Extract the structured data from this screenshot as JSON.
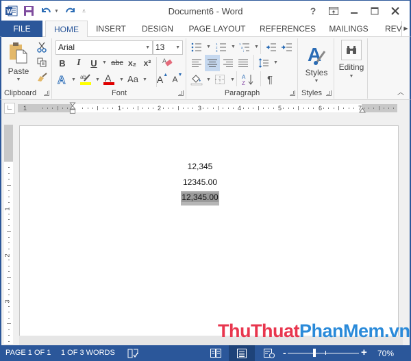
{
  "app": {
    "title": "Document6 - Word",
    "brand_color": "#2b579a"
  },
  "qat": {
    "word_icon": "word-app-icon",
    "save_icon": "save-icon",
    "undo_icon": "undo-icon",
    "redo_icon": "redo-icon",
    "customize_icon": "customize-qat-icon"
  },
  "window_controls": {
    "help": "?",
    "ribbon_display": "ribbon-display-options-icon",
    "minimize": "minimize-icon",
    "maximize": "maximize-icon",
    "close": "close-icon"
  },
  "tabs": [
    {
      "label": "FILE"
    },
    {
      "label": "HOME",
      "active": true
    },
    {
      "label": "INSERT"
    },
    {
      "label": "DESIGN"
    },
    {
      "label": "PAGE LAYOUT"
    },
    {
      "label": "REFERENCES"
    },
    {
      "label": "MAILINGS"
    },
    {
      "label": "REVI"
    }
  ],
  "ribbon": {
    "clipboard": {
      "label": "Clipboard",
      "paste_label": "Paste"
    },
    "font": {
      "label": "Font",
      "font_name": "Arial",
      "font_size": "13",
      "bold": "B",
      "italic": "I",
      "underline": "U",
      "strikethrough": "abc",
      "subscript": "x₂",
      "superscript": "x²",
      "change_case": "Aa",
      "grow_font": "A",
      "shrink_font": "A",
      "highlight_color": "#ffff00",
      "font_color": "#e00000"
    },
    "paragraph": {
      "label": "Paragraph",
      "active_alignment": "center"
    },
    "styles": {
      "label": "Styles",
      "button_label": "Styles"
    },
    "editing": {
      "button_label": "Editing"
    }
  },
  "ruler": {
    "horizontal_numbers": [
      "1",
      "1",
      "2",
      "3",
      "4",
      "5",
      "6",
      "7"
    ],
    "vertical_numbers": [
      "1",
      "2",
      "3"
    ]
  },
  "document": {
    "lines": [
      {
        "text": "12,345",
        "selected": false
      },
      {
        "text": "12345.00",
        "selected": false
      },
      {
        "text": "12,345.00",
        "selected": true
      }
    ]
  },
  "watermark": {
    "part1": "ThuThuat",
    "part2": "PhanMem.vn"
  },
  "statusbar": {
    "page": "PAGE 1 OF 1",
    "words": "1 OF 3 WORDS",
    "zoom_minus": "-",
    "zoom_plus": "+",
    "zoom_level": "70%",
    "active_view": "print-layout"
  }
}
